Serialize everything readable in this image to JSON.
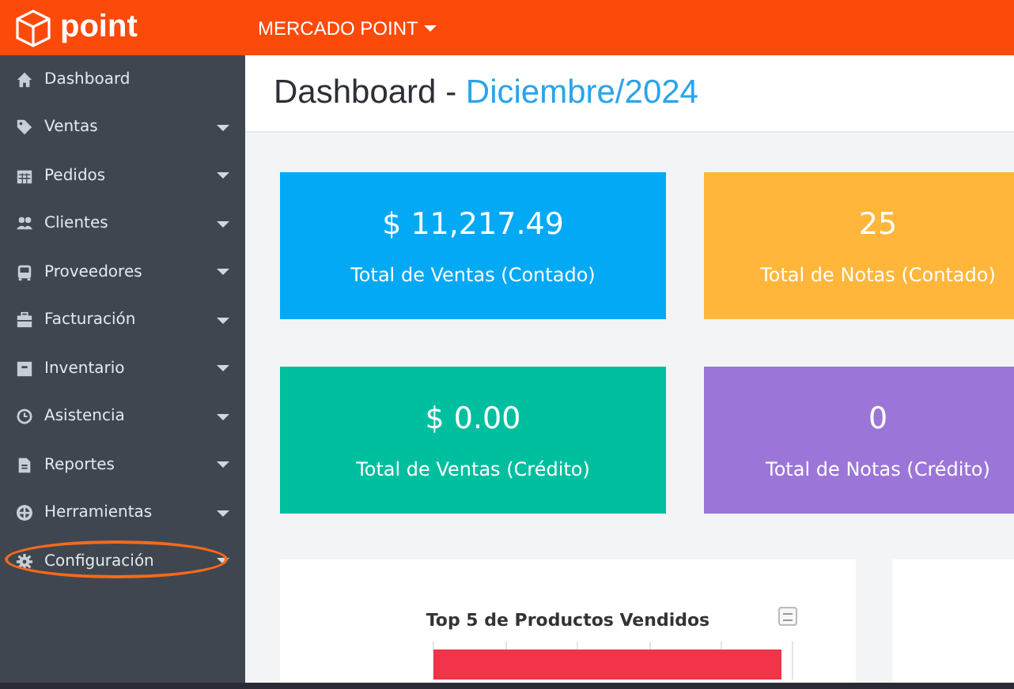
{
  "brand": {
    "name": "point"
  },
  "topbar": {
    "store_menu": "MERCADO POINT"
  },
  "sidebar": {
    "items": [
      {
        "label": "Dashboard",
        "has_submenu": false,
        "highlighted": false
      },
      {
        "label": "Ventas",
        "has_submenu": true,
        "highlighted": false
      },
      {
        "label": "Pedidos",
        "has_submenu": true,
        "highlighted": false
      },
      {
        "label": "Clientes",
        "has_submenu": true,
        "highlighted": false
      },
      {
        "label": "Proveedores",
        "has_submenu": true,
        "highlighted": false
      },
      {
        "label": "Facturación",
        "has_submenu": true,
        "highlighted": false
      },
      {
        "label": "Inventario",
        "has_submenu": true,
        "highlighted": false
      },
      {
        "label": "Asistencia",
        "has_submenu": true,
        "highlighted": false
      },
      {
        "label": "Reportes",
        "has_submenu": true,
        "highlighted": false
      },
      {
        "label": "Herramientas",
        "has_submenu": true,
        "highlighted": false
      },
      {
        "label": "Configuración",
        "has_submenu": true,
        "highlighted": true
      }
    ]
  },
  "header": {
    "title": "Dashboard - ",
    "period": "Diciembre/2024"
  },
  "stats": [
    {
      "value": "$ 11,217.49",
      "label": "Total de Ventas (Contado)",
      "color": "#03a9f4"
    },
    {
      "value": "25",
      "label": "Total de Notas (Contado)",
      "color": "#ffb63b"
    },
    {
      "value": "$ 0.00",
      "label": "Total de Ventas (Crédito)",
      "color": "#00bf9f"
    },
    {
      "value": "0",
      "label": "Total de Notas (Crédito)",
      "color": "#9b76d8"
    }
  ],
  "chart_panel": {
    "title": "Top 5 de Productos Vendidos"
  }
}
